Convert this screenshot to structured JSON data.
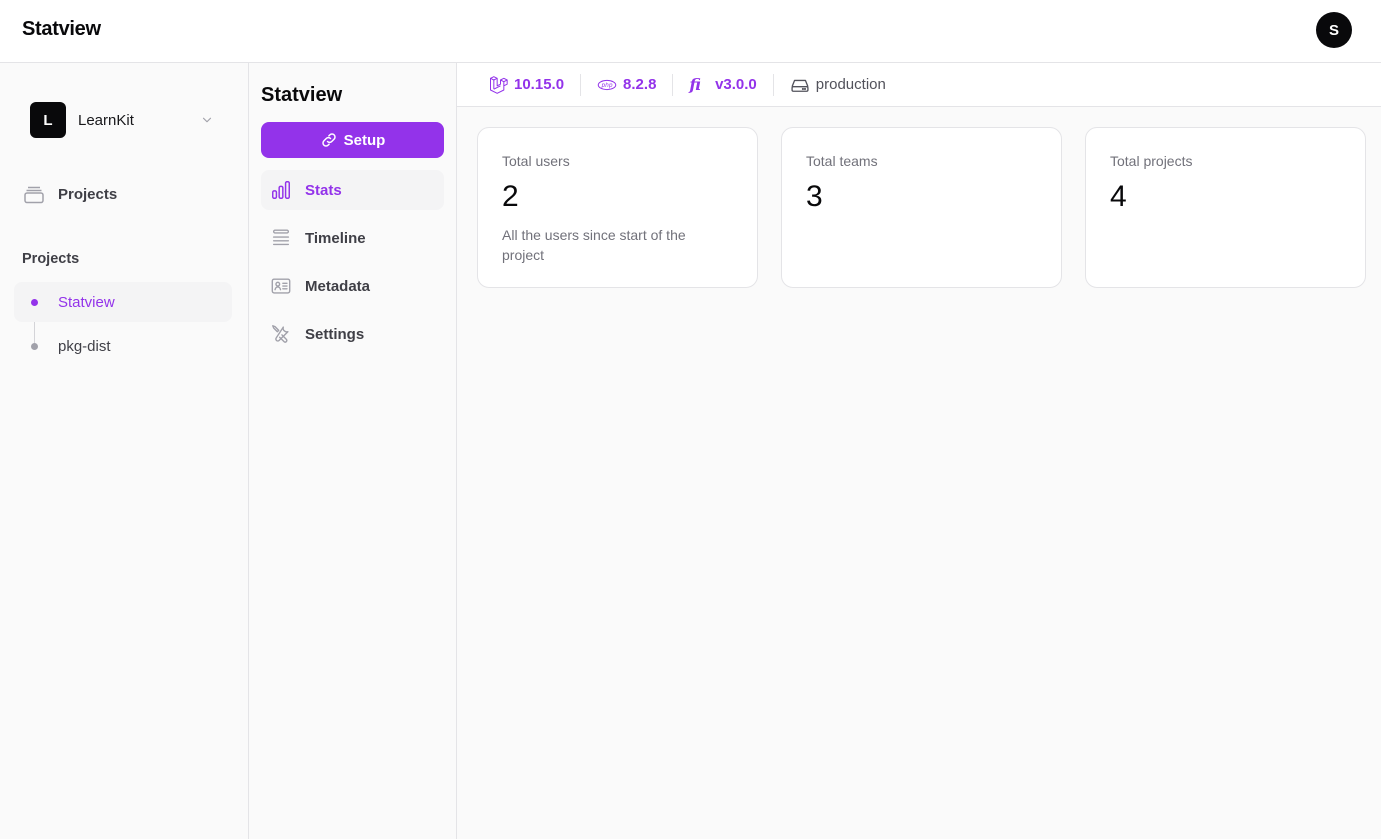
{
  "topbar": {
    "brand": "Statview",
    "avatar_initial": "S"
  },
  "sidebar": {
    "team": {
      "initial": "L",
      "name": "LearnKit"
    },
    "nav": [
      {
        "label": "Projects",
        "icon": "archive-icon"
      }
    ],
    "section_label": "Projects",
    "projects": [
      {
        "name": "Statview",
        "active": true
      },
      {
        "name": "pkg-dist",
        "active": false
      }
    ]
  },
  "subnav": {
    "title": "Statview",
    "setup_label": "Setup",
    "items": [
      {
        "label": "Stats",
        "icon": "bar-chart-icon",
        "active": true
      },
      {
        "label": "Timeline",
        "icon": "list-lines-icon",
        "active": false
      },
      {
        "label": "Metadata",
        "icon": "id-card-icon",
        "active": false
      },
      {
        "label": "Settings",
        "icon": "wrench-screwdriver-icon",
        "active": false
      }
    ]
  },
  "versions": {
    "laravel": "10.15.0",
    "php": "8.2.8",
    "filament_glyph": "fi",
    "filament": "v3.0.0",
    "environment": "production"
  },
  "stats": [
    {
      "label": "Total users",
      "value": "2",
      "description": "All the users since start of the project"
    },
    {
      "label": "Total teams",
      "value": "3",
      "description": ""
    },
    {
      "label": "Total projects",
      "value": "4",
      "description": ""
    }
  ],
  "colors": {
    "accent": "#9333ea",
    "dark": "#09090b",
    "muted": "#71717a",
    "border": "#e4e4e7"
  }
}
